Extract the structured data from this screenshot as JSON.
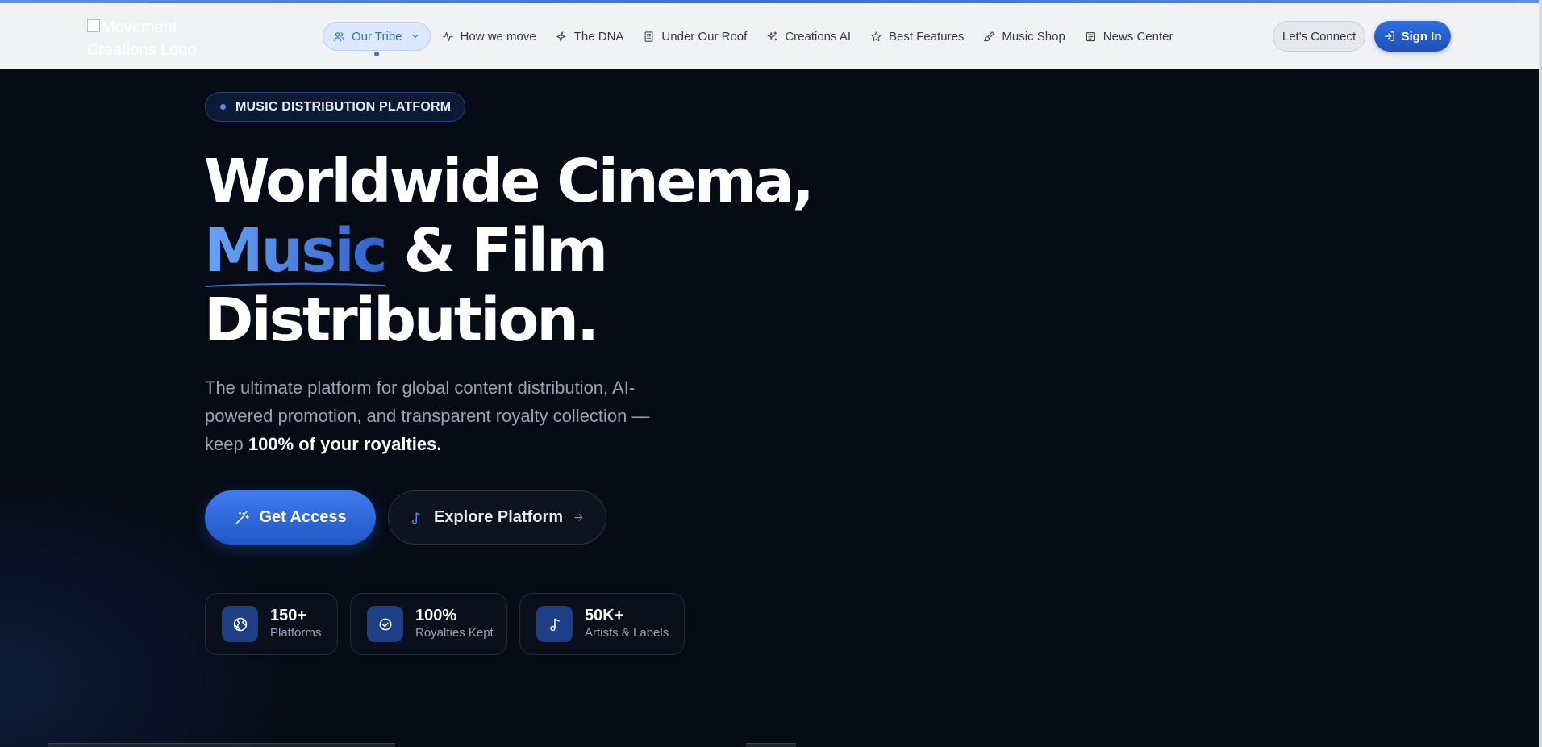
{
  "brand": {
    "logo_alt": "Movement Creations Logo"
  },
  "nav": {
    "items": [
      {
        "label": "Our Tribe",
        "icon": "users-icon"
      },
      {
        "label": "How we move",
        "icon": "activity-icon"
      },
      {
        "label": "The DNA",
        "icon": "sparkle-icon"
      },
      {
        "label": "Under Our Roof",
        "icon": "building-icon"
      },
      {
        "label": "Creations AI",
        "icon": "stars-icon"
      },
      {
        "label": "Best Features",
        "icon": "star-icon"
      },
      {
        "label": "Music Shop",
        "icon": "brush-icon"
      },
      {
        "label": "News Center",
        "icon": "newspaper-icon"
      }
    ],
    "connect_label": "Let's Connect",
    "signin_label": "Sign In"
  },
  "hero": {
    "badge": "MUSIC DISTRIBUTION PLATFORM",
    "headline_line1": "Worldwide Cinema,",
    "headline_highlight": "Music",
    "headline_line2_rest": " & Film",
    "headline_line3": "Distribution.",
    "subtitle_text": "The ultimate platform for global content distribution, AI-powered promotion, and transparent royalty collection — keep ",
    "subtitle_bold": "100% of your royalties.",
    "primary_cta": "Get Access",
    "secondary_cta": "Explore Platform"
  },
  "stats": [
    {
      "value": "150+",
      "label": "Platforms",
      "icon": "globe-icon"
    },
    {
      "value": "100%",
      "label": "Royalties Kept",
      "icon": "check-circle-icon"
    },
    {
      "value": "50K+",
      "label": "Artists & Labels",
      "icon": "music-note-icon"
    }
  ],
  "colors": {
    "accent": "#2f6fe0",
    "background": "#060b16",
    "navbar": "#f1f2f4"
  }
}
